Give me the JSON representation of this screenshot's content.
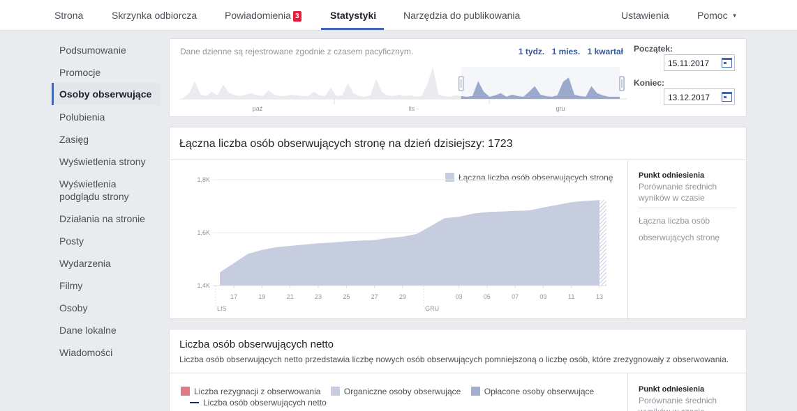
{
  "nav": {
    "tabs": [
      "Strona",
      "Skrzynka odbiorcza",
      "Powiadomienia",
      "Statystyki",
      "Narzędzia do publikowania"
    ],
    "notifications_badge": "3",
    "settings": "Ustawienia",
    "help": "Pomoc"
  },
  "sidebar": {
    "items": [
      "Podsumowanie",
      "Promocje",
      "Osoby obserwujące",
      "Polubienia",
      "Zasięg",
      "Wyświetlenia strony",
      "Wyświetlenia podglądu strony",
      "Działania na stronie",
      "Posty",
      "Wydarzenia",
      "Filmy",
      "Osoby",
      "Dane lokalne",
      "Wiadomości"
    ],
    "active_index": 2
  },
  "range": {
    "note": "Dane dzienne są rejestrowane zgodnie z czasem pacyficznym.",
    "links": [
      "1 tydz.",
      "1 mies.",
      "1 kwartał"
    ],
    "start_label": "Początek:",
    "start_value": "15.11.2017",
    "end_label": "Koniec:",
    "end_value": "13.12.2017",
    "months": [
      "paź",
      "lis",
      "gru"
    ]
  },
  "total": {
    "title": "Łączna liczba osób obserwujących stronę na dzień dzisiejszy: 1723",
    "legend": "Łączna liczba osób obserwujących stronę",
    "bench_title": "Punkt odniesienia",
    "bench_sub": "Porównanie średnich wyników w czasie",
    "bench_metric": "Łączna liczba osób obserwujących stronę"
  },
  "net": {
    "title": "Liczba osób obserwujących netto",
    "desc": "Liczba osób obserwujących netto przedstawia liczbę nowych osób obserwujących pomniejszoną o liczbę osób, które zrezygnowały z obserwowania.",
    "legend": [
      "Liczba rezygnacji z obserwowania",
      "Organiczne osoby obserwujące",
      "Opłacone osoby obserwujące",
      "Liczba osób obserwujących netto"
    ],
    "bench_title": "Punkt odniesienia",
    "bench_sub": "Porównanie średnich wyników w czasie"
  },
  "colors": {
    "accent": "#4267b2",
    "area": "#c6cddf",
    "unfollow": "#e07d84",
    "organic": "#c6cddf",
    "paid": "#a1aecf",
    "net_line": "#1d2d5c"
  },
  "chart_data": {
    "type": "area",
    "series": [
      {
        "name": "Łączna liczba osób obserwujących stronę",
        "x": [
          "16",
          "17",
          "18",
          "19",
          "20",
          "21",
          "22",
          "23",
          "24",
          "25",
          "26",
          "27",
          "28",
          "29",
          "30",
          "01",
          "02",
          "03",
          "04",
          "05",
          "06",
          "07",
          "08",
          "09",
          "10",
          "11",
          "12",
          "13"
        ],
        "values": [
          1450,
          1485,
          1520,
          1535,
          1545,
          1550,
          1555,
          1560,
          1563,
          1567,
          1570,
          1572,
          1580,
          1585,
          1595,
          1625,
          1655,
          1660,
          1672,
          1678,
          1680,
          1682,
          1684,
          1695,
          1705,
          1715,
          1720,
          1723
        ]
      }
    ],
    "x_tick_labels": [
      "17",
      "19",
      "21",
      "23",
      "25",
      "27",
      "29",
      "03",
      "05",
      "07",
      "09",
      "11",
      "13"
    ],
    "month_labels": [
      "LIS",
      "GRU"
    ],
    "y_tick_labels": [
      "1,4K",
      "1,6K",
      "1,8K"
    ],
    "ylim": [
      1400,
      1800
    ],
    "grid": true,
    "legend_position": "top-right"
  },
  "overview_chart": {
    "type": "area",
    "values": [
      2,
      8,
      25,
      6,
      4,
      10,
      5,
      20,
      9,
      5,
      4,
      6,
      8,
      5,
      4,
      12,
      6,
      4,
      4,
      6,
      5,
      4,
      4,
      10,
      5,
      4,
      16,
      4,
      5,
      22,
      8,
      4,
      3,
      5,
      28,
      10,
      5,
      4,
      6,
      4,
      5,
      3,
      4,
      20,
      45,
      6,
      4,
      3,
      5,
      4,
      3,
      4,
      25,
      10,
      3,
      5,
      8,
      3,
      6,
      4,
      3,
      10,
      18,
      6,
      4,
      3,
      5,
      24,
      30,
      6,
      4,
      3,
      18,
      8,
      5,
      3,
      3,
      3
    ],
    "selection_start_index": 49
  }
}
